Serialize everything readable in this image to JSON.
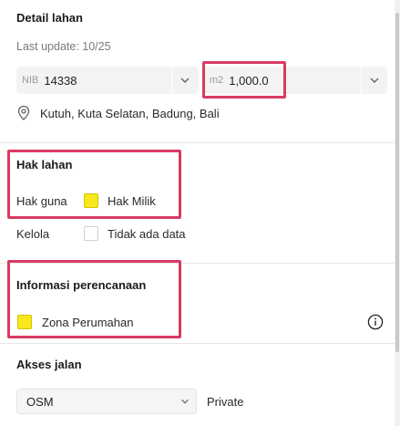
{
  "detail": {
    "title": "Detail lahan",
    "last_update": "Last update: 10/25",
    "nib_prefix": "NIB",
    "nib_value": "14338",
    "area_unit": "m2",
    "area_value": "1,000.0",
    "location": "Kutuh, Kuta Selatan, Badung, Bali"
  },
  "hak_lahan": {
    "title": "Hak lahan",
    "rows": [
      {
        "label": "Hak guna",
        "value": "Hak Milik",
        "color": "#f8e71c"
      },
      {
        "label": "Kelola",
        "value": "Tidak ada data",
        "color": "#ffffff"
      }
    ]
  },
  "perencanaan": {
    "title": "Informasi perencanaan",
    "zone_label": "Zona Perumahan",
    "zone_color": "#f8e71c"
  },
  "akses": {
    "title": "Akses jalan",
    "source_value": "OSM",
    "status": "Private"
  },
  "colors": {
    "highlight": "#d83b62",
    "field_bg": "#f3f3f3"
  }
}
